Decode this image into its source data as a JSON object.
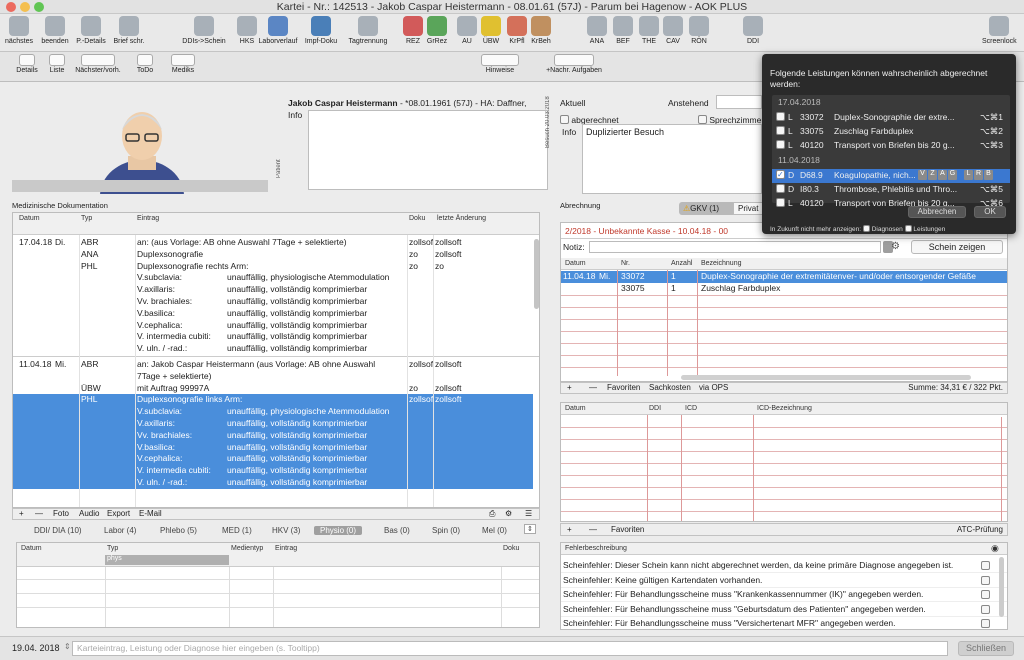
{
  "window": {
    "title": "Kartei - Nr.: 142513 - Jakob Caspar Heistermann - 08.01.61 (57J) - Parum bei Hagenow - AOK PLUS"
  },
  "toolbar": {
    "items": [
      {
        "label": "nächstes",
        "icon": "arrow-left-icon"
      },
      {
        "label": "beenden",
        "icon": "checkmark-icon"
      },
      {
        "label": "P.-Details",
        "icon": "person-icon"
      },
      {
        "label": "Brief schr.",
        "icon": "letter-icon"
      },
      {
        "label": "DDIs->Schein",
        "icon": "documents-icon"
      },
      {
        "label": "HKS",
        "icon": "skin-icon"
      },
      {
        "label": "Laborverlauf",
        "icon": "lab-flask-icon"
      },
      {
        "label": "Impf-Doku",
        "icon": "syringe-icon"
      },
      {
        "label": "Tagtrennung",
        "icon": "calendar-icon"
      },
      {
        "label": "REZ",
        "icon": "prescription-icon"
      },
      {
        "label": "GrRez",
        "icon": "green-prescription-icon"
      },
      {
        "label": "AU",
        "icon": "sick-note-icon"
      },
      {
        "label": "ÜBW",
        "icon": "referral-icon"
      },
      {
        "label": "KrPfl",
        "icon": "nursing-icon"
      },
      {
        "label": "KrBeh",
        "icon": "transport-icon"
      },
      {
        "label": "ANA",
        "icon": "stethoscope-icon"
      },
      {
        "label": "BEF",
        "icon": "findings-icon"
      },
      {
        "label": "THE",
        "icon": "therapy-icon"
      },
      {
        "label": "CAV",
        "icon": "cave-icon"
      },
      {
        "label": "RÖN",
        "icon": "xray-icon"
      },
      {
        "label": "DDI",
        "icon": "ddi-icon"
      },
      {
        "label": "Screenlock",
        "icon": "monitor-lock-icon"
      }
    ]
  },
  "toolbar2": {
    "items": [
      "Details",
      "Liste",
      "Nächster/vorh.",
      "ToDo",
      "Mediks"
    ],
    "hinweise": "Hinweise",
    "aufgaben": "+Nachr. Aufgaben"
  },
  "patient": {
    "label": "Patient",
    "name": "Jakob Caspar Heistermann",
    "info": "- *08.01.1961 (57J) - HA: Daffner,",
    "info_label": "Info"
  },
  "besuch": {
    "side_label": "Besuch 20.03.2018",
    "aktuell": "Aktuell",
    "anstehend": "Anstehend",
    "abgerechnet": "abgerechnet",
    "sprechzimmer": "Sprechzimmer",
    "info_label": "Info",
    "info_text": "Duplizierter Besuch"
  },
  "meddoc": {
    "section_title": "Medizinische Dokumentation",
    "columns": [
      "Datum",
      "Typ",
      "Eintrag",
      "Doku",
      "letzte Änderung"
    ],
    "rows": [
      {
        "date": "17.04.18",
        "day": "Di.",
        "typ": "ABR",
        "entry": "an:  (aus Vorlage: AB ohne Auswahl 7Tage + selektierte)",
        "doku": "zollsof",
        "changed": "zollsoft"
      },
      {
        "typ": "ANA",
        "entry": "Duplexsonografie",
        "doku": "zo",
        "changed": "zollsoft"
      },
      {
        "typ": "PHL",
        "entry": "Duplexsonografie rechts Arm:",
        "doku": "zo",
        "changed": "zo"
      },
      {
        "entry": "V.subclavia:",
        "value": "unauffällig, physiologische Atemmodulation"
      },
      {
        "entry": "V.axillaris:",
        "value": "unauffällig, vollständig komprimierbar"
      },
      {
        "entry": "Vv. brachiales:",
        "value": "unauffällig, vollständig komprimierbar"
      },
      {
        "entry": "V.basilica:",
        "value": "unauffällig, vollständig komprimierbar"
      },
      {
        "entry": "V.cephalica:",
        "value": "unauffällig, vollständig komprimierbar"
      },
      {
        "entry": "V. intermedia cubiti:",
        "value": "unauffällig, vollständig komprimierbar"
      },
      {
        "entry": "V. uln. / -rad.:",
        "value": "unauffällig, vollständig komprimierbar"
      },
      {
        "date": "11.04.18",
        "day": "Mi.",
        "typ": "ABR",
        "entry": "an: Jakob Caspar Heistermann (aus Vorlage: AB ohne Auswahl",
        "doku": "zollsof",
        "changed": "zollsoft"
      },
      {
        "entry": "7Tage + selektierte)"
      },
      {
        "typ": "ÜBW",
        "entry": "mit Auftrag 99997A",
        "doku": "zo",
        "changed": "zollsoft"
      },
      {
        "typ": "PHL",
        "entry": "Duplexsonografie links Arm:",
        "doku": "zollsof",
        "changed": "zollsoft"
      },
      {
        "entry": "V.subclavia:",
        "value": "unauffällig, physiologische Atemmodulation"
      },
      {
        "entry": "V.axillaris:",
        "value": "unauffällig, vollständig komprimierbar"
      },
      {
        "entry": "Vv. brachiales:",
        "value": "unauffällig, vollständig komprimierbar"
      },
      {
        "entry": "V.basilica:",
        "value": "unauffällig, vollständig komprimierbar"
      },
      {
        "entry": "V.cephalica:",
        "value": "unauffällig, vollständig komprimierbar"
      },
      {
        "entry": "V. intermedia cubiti:",
        "value": "unauffällig, vollständig komprimierbar"
      },
      {
        "entry": "V. uln. / -rad.:",
        "value": "unauffällig, vollständig komprimierbar"
      }
    ],
    "footer_buttons": [
      "+",
      "—",
      "Foto",
      "Audio",
      "Export",
      "E-Mail"
    ]
  },
  "bottom_tabs": [
    "DDI/ DIA (10)",
    "Labor (4)",
    "Phlebo (5)",
    "MED (1)",
    "HKV (3)",
    "Physio (0)",
    "Bas (0)",
    "Spin (0)",
    "Mel (0)"
  ],
  "bottom_table": {
    "columns": [
      "Datum",
      "Typ",
      "Medientyp",
      "Eintrag",
      "Doku"
    ],
    "typ_filter": "phys"
  },
  "abrechnung": {
    "title": "Abrechnung",
    "gkv_tab": "GKV (1)",
    "privat_tab": "Privat",
    "quarter": "2/2018 - Unbekannte Kasse - 10.04.18 - 00",
    "notiz_label": "Notiz:",
    "schein_button": "Schein zeigen",
    "columns": [
      "Datum",
      "Nr.",
      "Anzahl",
      "Bezeichnung"
    ],
    "rows": [
      {
        "date": "11.04.18",
        "day": "Mi.",
        "nr": "33072",
        "anzahl": "1",
        "bez": "Duplex-Sonographie der extremitätenver- und/oder entsorgender Gefäße"
      },
      {
        "nr": "33075",
        "anzahl": "1",
        "bez": "Zuschlag Farbduplex"
      }
    ],
    "footer": [
      "+",
      "—",
      "Favoriten",
      "Sachkosten",
      "via OPS"
    ],
    "sum": "Summe: 34,31 € / 322 Pkt."
  },
  "diagnosen": {
    "columns": [
      "Datum",
      "DDI",
      "ICD",
      "ICD-Bezeichnung"
    ],
    "footer": [
      "+",
      "—",
      "Favoriten"
    ],
    "atc": "ATC-Prüfung"
  },
  "fehler": {
    "title": "Fehlerbeschreibung",
    "items": [
      "Scheinfehler: Dieser Schein kann nicht abgerechnet werden, da keine primäre Diagnose angegeben ist.",
      "Scheinfehler: Keine gültigen Kartendaten vorhanden.",
      "Scheinfehler: Für Behandlungsscheine muss \"Krankenkassennummer (IK)\" angegeben werden.",
      "Scheinfehler: Für Behandlungsscheine muss \"Geburtsdatum des Patienten\" angegeben werden.",
      "Scheinfehler: Für Behandlungsscheine muss \"Versichertenart MFR\" angegeben werden."
    ]
  },
  "bottombar": {
    "date": "19.04. 2018",
    "placeholder": "Karteieintrag, Leistung oder Diagnose hier eingeben (s. Tooltipp)",
    "close": "Schließen"
  },
  "popup": {
    "heading": "Folgende Leistungen können wahrscheinlich abgerechnet werden:",
    "groups": [
      {
        "date": "17.04.2018",
        "items": [
          {
            "kind": "L",
            "code": "33072",
            "text": "Duplex-Sonographie der extre...",
            "shortcut": "⌥⌘1",
            "checked": false
          },
          {
            "kind": "L",
            "code": "33075",
            "text": "Zuschlag Farbduplex",
            "shortcut": "⌥⌘2",
            "checked": false
          },
          {
            "kind": "L",
            "code": "40120",
            "text": "Transport von Briefen bis 20 g...",
            "shortcut": "⌥⌘3",
            "checked": false
          }
        ]
      },
      {
        "date": "11.04.2018",
        "items": [
          {
            "kind": "D",
            "code": "D68.9",
            "text": "Koagulopathie, nich...",
            "badges": [
              "V",
              "Z",
              "A",
              "G",
              "L",
              "R",
              "B"
            ],
            "checked": true
          },
          {
            "kind": "D",
            "code": "I80.3",
            "text": "Thrombose, Phlebitis und Thro...",
            "shortcut": "⌥⌘5",
            "checked": false
          },
          {
            "kind": "L",
            "code": "40120",
            "text": "Transport von Briefen bis 20 g...",
            "shortcut": "⌥⌘6",
            "checked": false
          }
        ]
      }
    ],
    "cancel": "Abbrechen",
    "ok": "OK",
    "future_label": "In Zukunft nicht mehr anzeigen:",
    "diagnosen": "Diagnosen",
    "leistungen": "Leistungen"
  },
  "colors": {
    "selection": "#4a8edb",
    "accent_red": "#c0392b",
    "popup_bg": "#2a2a2a"
  }
}
